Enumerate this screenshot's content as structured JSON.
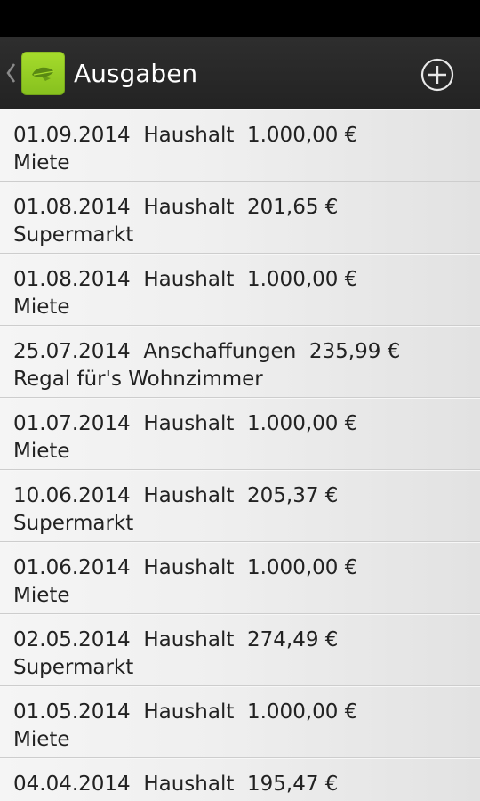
{
  "screen": {
    "title": "Ausgaben",
    "up_icon": "chevron-left-icon",
    "app_icon": "leaf-icon",
    "add_icon": "plus-circle-icon"
  },
  "colors": {
    "status_bar": "#000000",
    "action_bar": "#2a2a2a",
    "app_icon_green": "#93cc24",
    "list_background": "#efefef",
    "text": "#222222"
  },
  "expenses": [
    {
      "date": "01.09.2014",
      "category": "Haushalt",
      "amount": "1.000,00 €",
      "description": "Miete"
    },
    {
      "date": "01.08.2014",
      "category": "Haushalt",
      "amount": "201,65 €",
      "description": "Supermarkt"
    },
    {
      "date": "01.08.2014",
      "category": "Haushalt",
      "amount": "1.000,00 €",
      "description": "Miete"
    },
    {
      "date": "25.07.2014",
      "category": "Anschaffungen",
      "amount": "235,99 €",
      "description": "Regal für's Wohnzimmer"
    },
    {
      "date": "01.07.2014",
      "category": "Haushalt",
      "amount": "1.000,00 €",
      "description": "Miete"
    },
    {
      "date": "10.06.2014",
      "category": "Haushalt",
      "amount": "205,37 €",
      "description": "Supermarkt"
    },
    {
      "date": "01.06.2014",
      "category": "Haushalt",
      "amount": "1.000,00 €",
      "description": "Miete"
    },
    {
      "date": "02.05.2014",
      "category": "Haushalt",
      "amount": "274,49 €",
      "description": "Supermarkt"
    },
    {
      "date": "01.05.2014",
      "category": "Haushalt",
      "amount": "1.000,00 €",
      "description": "Miete"
    },
    {
      "date": "04.04.2014",
      "category": "Haushalt",
      "amount": "195,47 €",
      "description": ""
    }
  ]
}
